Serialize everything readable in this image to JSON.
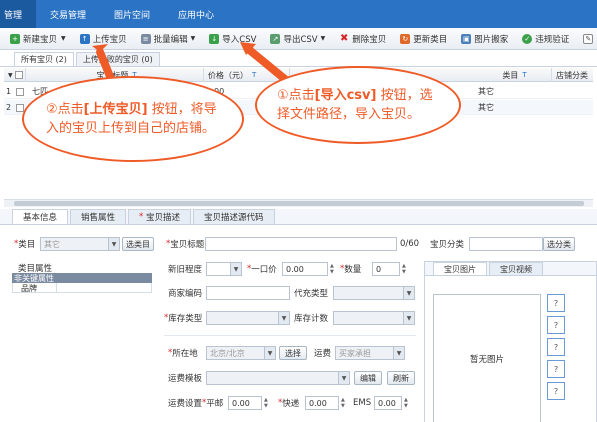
{
  "nav": {
    "tabs": [
      "管理",
      "交易管理",
      "图片空间",
      "应用中心"
    ],
    "active_index": 0
  },
  "toolbar": {
    "new_item": "新建宝贝",
    "upload": "上传宝贝",
    "batch_edit": "批量编辑",
    "import_csv": "导入CSV",
    "export_csv": "导出CSV",
    "delete": "删除宝贝",
    "update_category": "更新类目",
    "image_move": "图片搬家",
    "violation_check": "违规验证"
  },
  "list_tabs": [
    "所有宝贝 (2)",
    "上传失败的宝贝 (0)"
  ],
  "grid": {
    "headers": [
      "宝贝标题",
      "价格（元）",
      "类目",
      "店铺分类"
    ],
    "rows": [
      {
        "title": "七匹",
        "price": "00",
        "category": "其它"
      },
      {
        "title": "",
        "price": "",
        "category": "其它"
      }
    ]
  },
  "bottom_tabs": [
    "基本信息",
    "销售属性",
    "宝贝描述",
    "宝贝描述源代码"
  ],
  "form": {
    "category_label": "类目",
    "category_value": "其它",
    "select_category_btn": "选类目",
    "attr_title": "类目属性",
    "nonkey_attr": "非关键属性",
    "brand_label": "品牌",
    "title_label": "宝贝标题",
    "title_counter": "0/60",
    "shop_category_label": "宝贝分类",
    "select_shop_category_btn": "选分类",
    "newness_label": "新旧程度",
    "price_label": "一口价",
    "price_value": "0.00",
    "quantity_label": "数量",
    "quantity_value": "0",
    "merchant_code_label": "商家编码",
    "proxy_type_label": "代充类型",
    "stock_type_label": "库存类型",
    "stock_count_label": "库存计数",
    "location_label": "所在地",
    "location_value": "北京/北京",
    "choose_btn": "选择",
    "freight_label": "运费",
    "freight_value": "买家承担",
    "freight_template_label": "运费模板",
    "edit_btn": "编辑",
    "refresh_btn": "刷新",
    "freight_setting_label": "运费设置",
    "mail_label": "平邮",
    "mail_value": "0.00",
    "express_label": "快递",
    "express_value": "0.00",
    "ems_label": "EMS",
    "ems_value": "0.00"
  },
  "image_panel": {
    "tabs": [
      "宝贝图片",
      "宝贝视频"
    ],
    "no_image": "暂无图片",
    "slots": [
      "?",
      "?",
      "?",
      "?",
      "?"
    ]
  },
  "callouts": {
    "left_prefix": "②点击",
    "left_bold": "[上传宝贝]",
    "left_suffix": " 按钮，将导入的宝贝上传到自己的店铺。",
    "right_prefix": "①点击",
    "right_bold": "[导入csv]",
    "right_suffix": " 按钮，选择文件路径，导入宝贝。",
    "color": "#ef5b27"
  }
}
